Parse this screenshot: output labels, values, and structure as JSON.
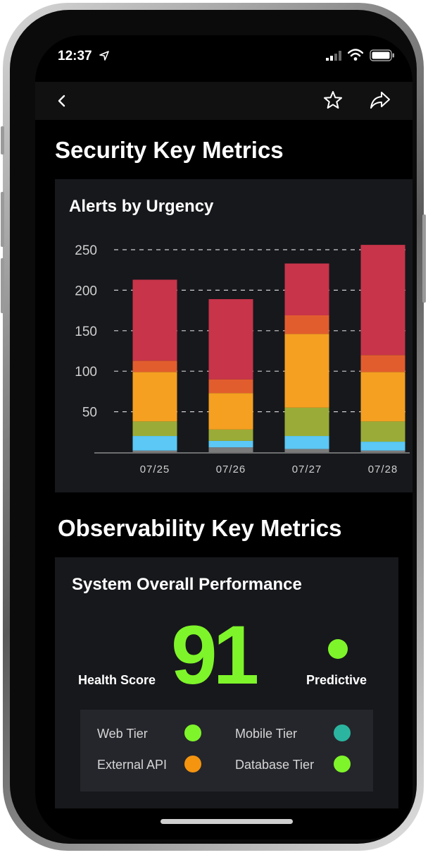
{
  "status_bar": {
    "time": "12:37"
  },
  "security": {
    "title": "Security Key Metrics",
    "card_title": "Alerts by Urgency",
    "chart_data": {
      "type": "bar",
      "stacked": true,
      "categories": [
        "07/25",
        "07/26",
        "07/27",
        "07/28"
      ],
      "y_ticks": [
        "250",
        "200",
        "150",
        "100",
        "50"
      ],
      "ylim": [
        0,
        260
      ],
      "grid": true,
      "series": [
        {
          "color": "#7b7b7b",
          "values": [
            2,
            6,
            4,
            2
          ]
        },
        {
          "color": "#5bc8f5",
          "values": [
            18,
            8,
            16,
            11
          ]
        },
        {
          "color": "#9aac37",
          "values": [
            18,
            14,
            35,
            25
          ]
        },
        {
          "color": "#f5a021",
          "values": [
            61,
            45,
            91,
            61
          ]
        },
        {
          "color": "#e25d2e",
          "values": [
            14,
            17,
            23,
            21
          ]
        },
        {
          "color": "#c8344a",
          "values": [
            100,
            99,
            64,
            136
          ]
        }
      ]
    }
  },
  "observability": {
    "title": "Observability Key Metrics",
    "card_title": "System Overall Performance",
    "health_score_value": "91",
    "health_score_label": "Health Score",
    "predictive_label": "Predictive",
    "predictive_color": "#7ef52a",
    "tiers": [
      {
        "name": "Web Tier",
        "color": "#7ef52a"
      },
      {
        "name": "Mobile Tier",
        "color": "#2bb5a0"
      },
      {
        "name": "External API",
        "color": "#f4940f"
      },
      {
        "name": "Database Tier",
        "color": "#7ef52a"
      }
    ]
  },
  "icons": {
    "back": "chevron-left-icon",
    "favorite": "star-icon",
    "share": "share-icon"
  }
}
